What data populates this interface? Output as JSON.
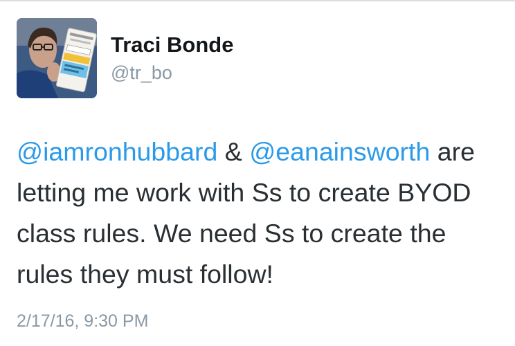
{
  "tweet": {
    "author": {
      "display_name": "Traci Bonde",
      "handle": "@tr_bo"
    },
    "body": {
      "mention_1": "@iamronhubbard",
      "connector": " & ",
      "mention_2": "@eanainsworth",
      "text": " are letting me work with Ss to create BYOD class rules. We need Ss to create the rules they must follow!"
    },
    "timestamp": "2/17/16, 9:30 PM"
  },
  "colors": {
    "link": "#2b9ae8",
    "body_text": "#292f33",
    "secondary_text": "#8899a6"
  }
}
